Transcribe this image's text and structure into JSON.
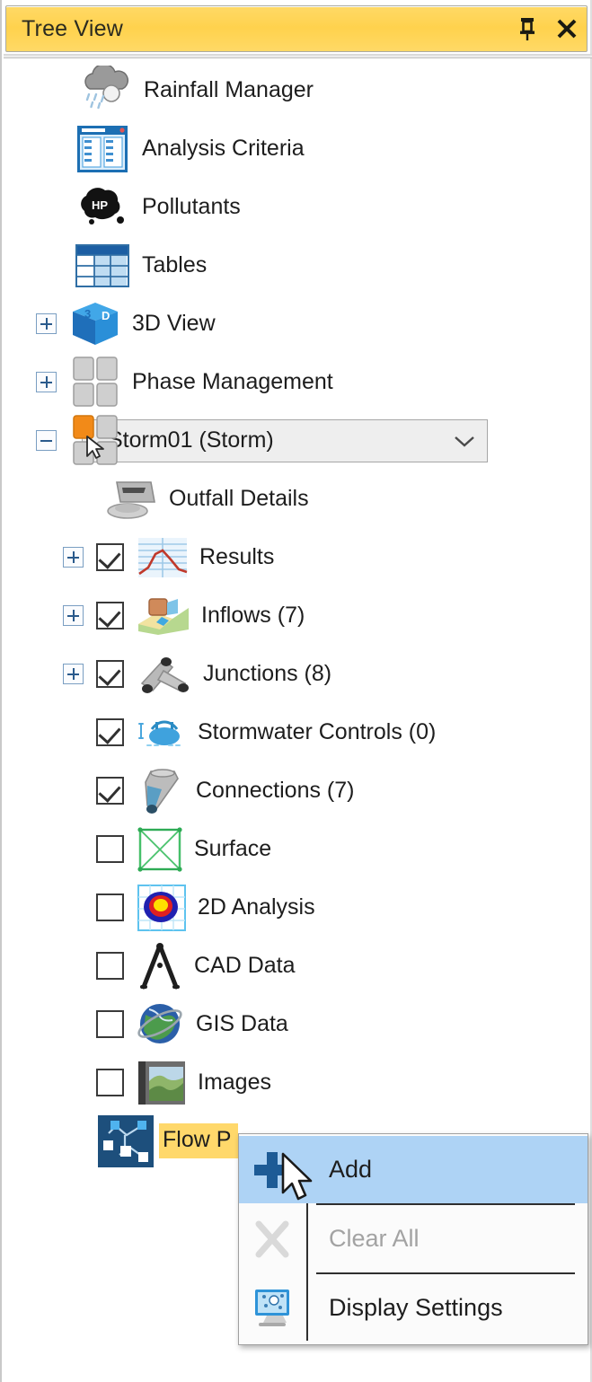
{
  "window": {
    "title": "Tree View",
    "pin_icon": "pushpin-icon",
    "close_icon": "close-icon",
    "titlebar_color": "#ffd24d"
  },
  "tree": {
    "items": [
      {
        "label": "Rainfall Manager",
        "icon": "rain-cloud-icon",
        "indent": 0,
        "expander": "none",
        "checkbox": "none"
      },
      {
        "label": "Analysis Criteria",
        "icon": "analysis-criteria-icon",
        "indent": 0,
        "expander": "none",
        "checkbox": "none"
      },
      {
        "label": "Pollutants",
        "icon": "pollutants-icon",
        "indent": 0,
        "expander": "none",
        "checkbox": "none"
      },
      {
        "label": "Tables",
        "icon": "tables-icon",
        "indent": 0,
        "expander": "none",
        "checkbox": "none"
      },
      {
        "label": "3D View",
        "icon": "cube-3d-icon",
        "indent": 0,
        "expander": "plus",
        "checkbox": "none"
      },
      {
        "label": "Phase Management",
        "icon": "phase-management-icon",
        "indent": 0,
        "expander": "plus",
        "checkbox": "none"
      },
      {
        "label": "Storm01 (Storm)",
        "icon": "phase-active-icon",
        "indent": 0,
        "expander": "minus",
        "checkbox": "none",
        "control": "combobox"
      },
      {
        "label": "Outfall Details",
        "icon": "outfall-icon",
        "indent": 1,
        "expander": "none",
        "checkbox": "none"
      },
      {
        "label": "Results",
        "icon": "results-icon",
        "indent": 1,
        "expander": "plus",
        "checkbox": "checked"
      },
      {
        "label": "Inflows (7)",
        "icon": "inflows-icon",
        "indent": 1,
        "expander": "plus",
        "checkbox": "checked"
      },
      {
        "label": "Junctions (8)",
        "icon": "junctions-icon",
        "indent": 1,
        "expander": "plus",
        "checkbox": "checked"
      },
      {
        "label": "Stormwater Controls (0)",
        "icon": "stormwater-controls-icon",
        "indent": 1,
        "expander": "blank",
        "checkbox": "checked"
      },
      {
        "label": "Connections (7)",
        "icon": "connections-icon",
        "indent": 1,
        "expander": "blank",
        "checkbox": "checked"
      },
      {
        "label": "Surface",
        "icon": "surface-icon",
        "indent": 1,
        "expander": "blank",
        "checkbox": "unchecked"
      },
      {
        "label": "2D Analysis",
        "icon": "analysis-2d-icon",
        "indent": 1,
        "expander": "blank",
        "checkbox": "unchecked"
      },
      {
        "label": "CAD Data",
        "icon": "cad-data-icon",
        "indent": 1,
        "expander": "blank",
        "checkbox": "unchecked"
      },
      {
        "label": "GIS Data",
        "icon": "gis-data-icon",
        "indent": 1,
        "expander": "blank",
        "checkbox": "unchecked"
      },
      {
        "label": "Images",
        "icon": "images-icon",
        "indent": 1,
        "expander": "blank",
        "checkbox": "unchecked"
      },
      {
        "label": "Flow P",
        "icon": "flow-path-icon",
        "indent": 1,
        "expander": "blank",
        "checkbox": "none",
        "selected": true
      }
    ],
    "selection_color": "#ffd86b"
  },
  "combobox": {
    "value": "Storm01 (Storm)",
    "chevron_icon": "chevron-down-icon"
  },
  "context_menu": {
    "items": [
      {
        "label": "Add",
        "icon": "plus-icon",
        "state": "highlighted"
      },
      {
        "label": "Clear All",
        "icon": "clear-all-x-icon",
        "state": "disabled"
      },
      {
        "label": "Display Settings",
        "icon": "display-settings-icon",
        "state": "normal"
      }
    ],
    "highlight_color": "#aed3f5"
  },
  "cursor": {
    "icon": "mouse-pointer-icon"
  }
}
